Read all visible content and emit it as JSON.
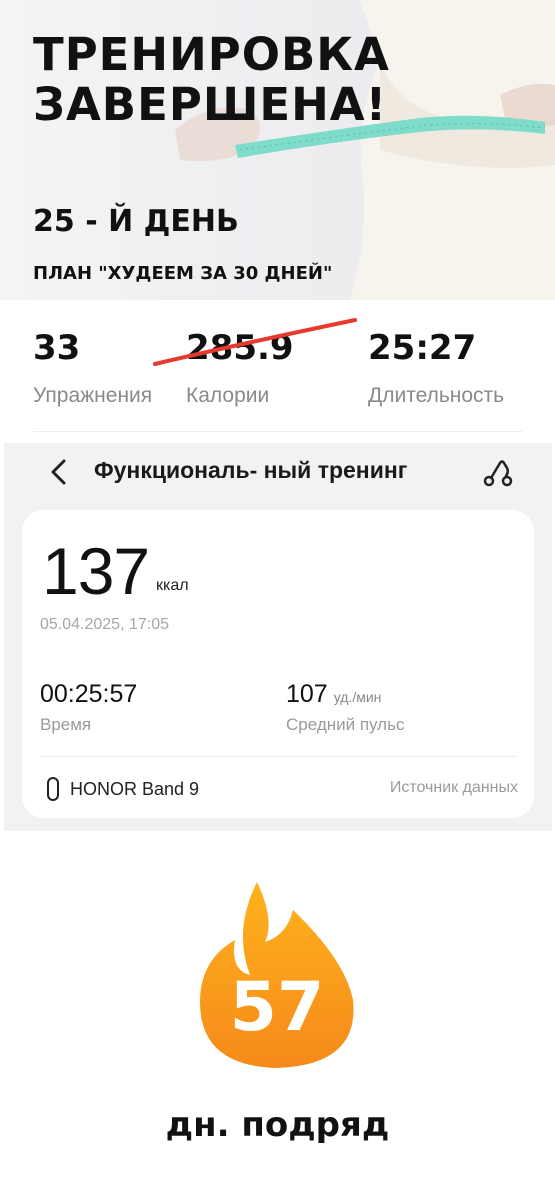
{
  "hero": {
    "title_line1": "ТРЕНИРОВКА",
    "title_line2": "ЗАВЕРШЕНА!",
    "day": "25 - Й ДЕНЬ",
    "plan": "ПЛАН \"ХУДЕЕМ ЗА 30 ДНЕЙ\""
  },
  "stats": [
    {
      "value": "33",
      "label": "Упражнения"
    },
    {
      "value": "285.9",
      "label": "Калории",
      "crossed_out": true
    },
    {
      "value": "25:27",
      "label": "Длительность"
    }
  ],
  "health": {
    "back_icon": "chevron-left-icon",
    "title": "Функциональ- ный тренинг",
    "route_icon": "route-icon",
    "calories": "137",
    "calories_unit": "ккал",
    "datetime": "05.04.2025, 17:05",
    "time_value": "00:25:57",
    "time_label": "Время",
    "pulse_value": "107",
    "pulse_unit": "уд./мин",
    "pulse_label": "Средний пульс",
    "device_icon": "fitness-band-icon",
    "device_name": "HONOR Band 9",
    "source_link": "Источник данных"
  },
  "streak": {
    "count": "57",
    "label": "дн. подряд",
    "icon": "flame-icon"
  },
  "colors": {
    "strike": "#e63a2e",
    "tape": "#6ad8c4",
    "flame_top": "#ffb21d",
    "flame_bottom": "#f58a1a",
    "health_bg": "#f1f2f4"
  }
}
